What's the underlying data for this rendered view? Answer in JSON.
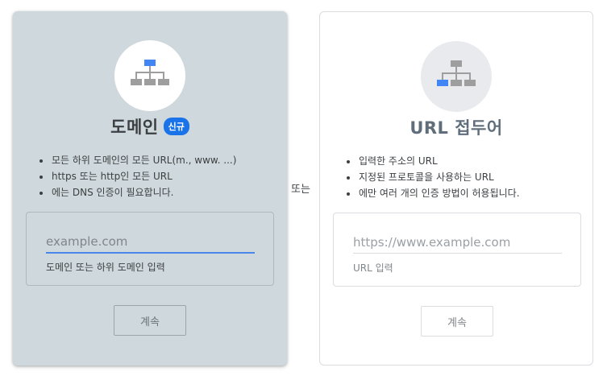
{
  "domain_card": {
    "title": "도메인",
    "badge": "신규",
    "bullets": [
      "모든 하위 도메인의 모든 URL(m., www. ...)",
      "https 또는 http인 모든 URL",
      "에는 DNS 인증이 필요합니다."
    ],
    "input_placeholder": "example.com",
    "input_value": "",
    "helper": "도메인 또는 하위 도메인 입력",
    "continue_label": "계속",
    "icon": "sitemap-icon",
    "icon_highlight_color": "#4285f4"
  },
  "separator": "또는",
  "prefix_card": {
    "title": "URL 접두어",
    "bullets": [
      "입력한 주소의 URL",
      "지정된 프로토콜을 사용하는 URL",
      "에만 여러 개의 인증 방법이 허용됩니다."
    ],
    "input_placeholder": "https://www.example.com",
    "input_value": "",
    "helper": "URL 입력",
    "continue_label": "계속",
    "icon": "sitemap-icon",
    "icon_highlight_color": "#4285f4"
  }
}
